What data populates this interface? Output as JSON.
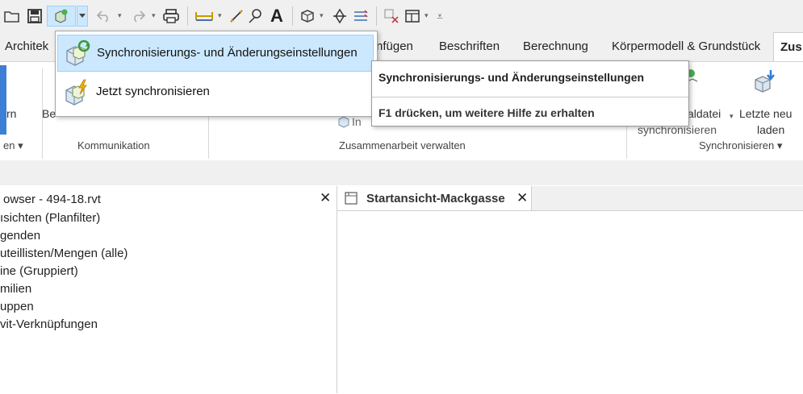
{
  "tabs": {
    "architektur": "Architek",
    "einfuegen": "nfügen",
    "beschriften": "Beschriften",
    "berechnung": "Berechnung",
    "koerpermodell": "Körpermodell & Grundstück",
    "zusammenarbeit": "Zus"
  },
  "ribbon": {
    "left_fragment": "rn",
    "be_fragment": "Be",
    "in_fragment": "In",
    "panel_left": "en ▾",
    "panel_kommunikation": "Kommunikation",
    "panel_zusammenarbeit": "Zusammenarbeit verwalten",
    "panel_synchronisieren": "Synchronisieren ▾",
    "zentraldatei_line1": "aldatei",
    "zentraldatei_line2": "synchronisieren",
    "letzte_line1": "Letzte neu",
    "letzte_line2": "laden"
  },
  "dropdown": {
    "items": [
      {
        "label": "Synchronisierungs- und Änderungseinstellungen",
        "icon": "sync-settings-icon"
      },
      {
        "label": "Jetzt synchronisieren",
        "icon": "sync-now-icon"
      }
    ]
  },
  "tooltip": {
    "title": "Synchronisierungs- und Änderungseinstellungen",
    "help": "F1 drücken, um weitere Hilfe zu erhalten"
  },
  "browser": {
    "title": "owser - 494-18.rvt",
    "close": "✕",
    "items": [
      "ısichten (Planfilter)",
      "genden",
      "uteillisten/Mengen (alle)",
      "ine (Gruppiert)",
      "milien",
      "uppen",
      "vit-Verknüpfungen"
    ]
  },
  "view": {
    "tab_label": "Startansicht-Mackgasse",
    "close": "✕"
  },
  "colors": {
    "hover_bg": "#cce8ff",
    "hover_border": "#99d1ff",
    "toolbar_bg": "#f0f0f0"
  }
}
